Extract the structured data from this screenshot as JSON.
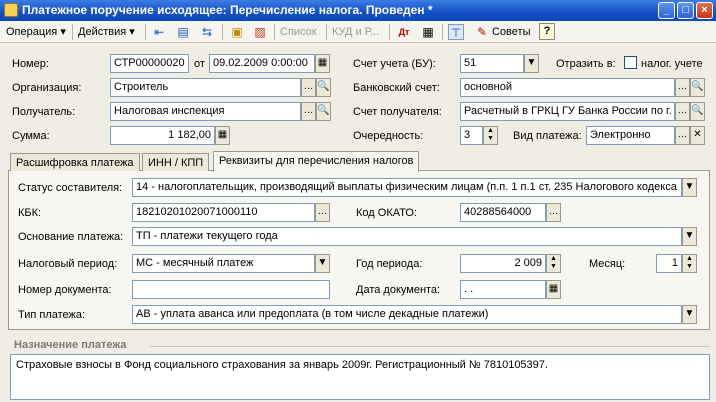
{
  "window": {
    "title": "Платежное поручение исходящее: Перечисление налога. Проведен *",
    "minimize": "_",
    "maximize": "□",
    "close": "×"
  },
  "toolbar": {
    "operation": "Операция ▾",
    "actions": "Действия ▾",
    "list": "Список",
    "kud": "КУД и Р...",
    "advice": "Советы",
    "help": "?"
  },
  "form": {
    "number_label": "Номер:",
    "number": "СТР00000020",
    "from_label": "от",
    "date": "09.02.2009  0:00:00",
    "account_bu_label": "Счет учета (БУ):",
    "account_bu": "51",
    "reflect_label": "Отразить в:",
    "tax_account_label": "налог. учете",
    "org_label": "Организация:",
    "org": "Строитель",
    "bank_account_label": "Банковский счет:",
    "bank_account": "основной",
    "recipient_label": "Получатель:",
    "recipient": "Налоговая инспекция",
    "recipient_account_label": "Счет получателя:",
    "recipient_account": "Расчетный в ГРКЦ ГУ Банка России по г.",
    "sum_label": "Сумма:",
    "sum": "1 182,00",
    "priority_label": "Очередность:",
    "priority": "3",
    "payment_kind_label": "Вид платежа:",
    "payment_kind": "Электронно"
  },
  "tabs": [
    {
      "label": "Расшифровка платежа"
    },
    {
      "label": "ИНН / КПП"
    },
    {
      "label": "Реквизиты для перечисления налогов"
    }
  ],
  "tax": {
    "status_label": "Статус составителя:",
    "status": "14 - налогоплательщик, производящий выплаты физическим лицам (п.п. 1 п.1 ст. 235 Налогового кодекса",
    "kbk_label": "КБК:",
    "kbk": "18210201020071000110",
    "okato_label": "Код ОКАТО:",
    "okato": "40288564000",
    "basis_label": "Основание платежа:",
    "basis": "ТП - платежи текущего года",
    "period_label": "Налоговый период:",
    "period": "МС - месячный платеж",
    "year_label": "Год периода:",
    "year": "2 009",
    "month_label": "Месяц:",
    "month": "1",
    "doc_number_label": "Номер документа:",
    "doc_number": "",
    "doc_date_label": "Дата документа:",
    "doc_date": " .  .",
    "payment_type_label": "Тип платежа:",
    "payment_type": "АВ - уплата аванса или предоплата (в том числе декадные платежи)"
  },
  "purpose": {
    "title": "Назначение платежа",
    "text": "Страховые взносы в Фонд социального страхования за январь 2009г. Регистрационный № 7810105397."
  }
}
